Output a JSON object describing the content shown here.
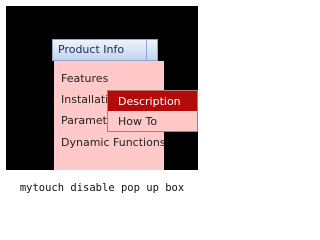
{
  "menu": {
    "top_item": "Product Info",
    "items": [
      "Features",
      "Installation",
      "Parameters",
      "Dynamic Functions"
    ],
    "submenu": [
      "Description",
      "How To"
    ]
  },
  "caption": "mytouch disable pop up box",
  "colors": {
    "background": "#000000",
    "menu_bg": "#ffc9c9",
    "highlight": "#b40a0a",
    "bar": "#c4d4ec"
  }
}
